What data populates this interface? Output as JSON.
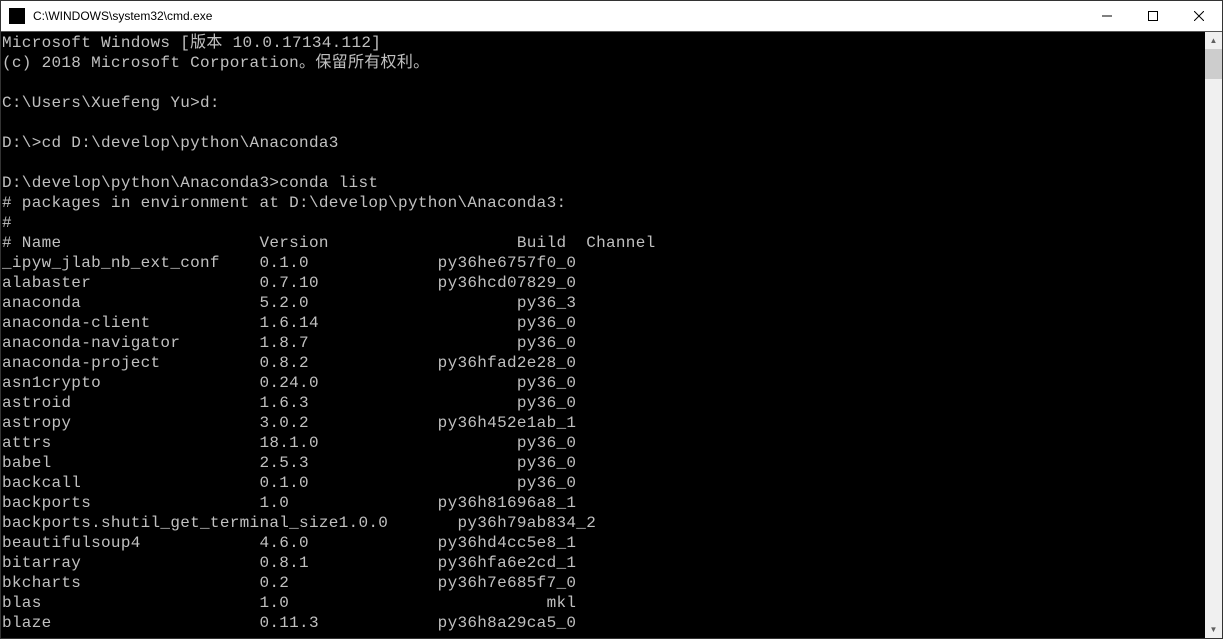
{
  "window": {
    "title": "C:\\WINDOWS\\system32\\cmd.exe"
  },
  "terminal": {
    "banner_line1": "Microsoft Windows [版本 10.0.17134.112]",
    "banner_line2": "(c) 2018 Microsoft Corporation。保留所有权利。",
    "prompt1": "C:\\Users\\Xuefeng Yu>d:",
    "prompt2": "D:\\>cd D:\\develop\\python\\Anaconda3",
    "prompt3": "D:\\develop\\python\\Anaconda3>conda list",
    "env_header": "# packages in environment at D:\\develop\\python\\Anaconda3:",
    "hash_line": "#",
    "columns_line": "# Name                    Version                   Build  Channel",
    "packages": [
      {
        "name": "_ipyw_jlab_nb_ext_conf",
        "version": "0.1.0",
        "build": "py36he6757f0_0"
      },
      {
        "name": "alabaster",
        "version": "0.7.10",
        "build": "py36hcd07829_0"
      },
      {
        "name": "anaconda",
        "version": "5.2.0",
        "build": "py36_3"
      },
      {
        "name": "anaconda-client",
        "version": "1.6.14",
        "build": "py36_0"
      },
      {
        "name": "anaconda-navigator",
        "version": "1.8.7",
        "build": "py36_0"
      },
      {
        "name": "anaconda-project",
        "version": "0.8.2",
        "build": "py36hfad2e28_0"
      },
      {
        "name": "asn1crypto",
        "version": "0.24.0",
        "build": "py36_0"
      },
      {
        "name": "astroid",
        "version": "1.6.3",
        "build": "py36_0"
      },
      {
        "name": "astropy",
        "version": "3.0.2",
        "build": "py36h452e1ab_1"
      },
      {
        "name": "attrs",
        "version": "18.1.0",
        "build": "py36_0"
      },
      {
        "name": "babel",
        "version": "2.5.3",
        "build": "py36_0"
      },
      {
        "name": "backcall",
        "version": "0.1.0",
        "build": "py36_0"
      },
      {
        "name": "backports",
        "version": "1.0",
        "build": "py36h81696a8_1"
      },
      {
        "name": "backports.shutil_get_terminal_size",
        "version": "1.0.0",
        "build": "py36h79ab834_2"
      },
      {
        "name": "beautifulsoup4",
        "version": "4.6.0",
        "build": "py36hd4cc5e8_1"
      },
      {
        "name": "bitarray",
        "version": "0.8.1",
        "build": "py36hfa6e2cd_1"
      },
      {
        "name": "bkcharts",
        "version": "0.2",
        "build": "py36h7e685f7_0"
      },
      {
        "name": "blas",
        "version": "1.0",
        "build": "mkl"
      },
      {
        "name": "blaze",
        "version": "0.11.3",
        "build": "py36h8a29ca5_0"
      }
    ]
  }
}
